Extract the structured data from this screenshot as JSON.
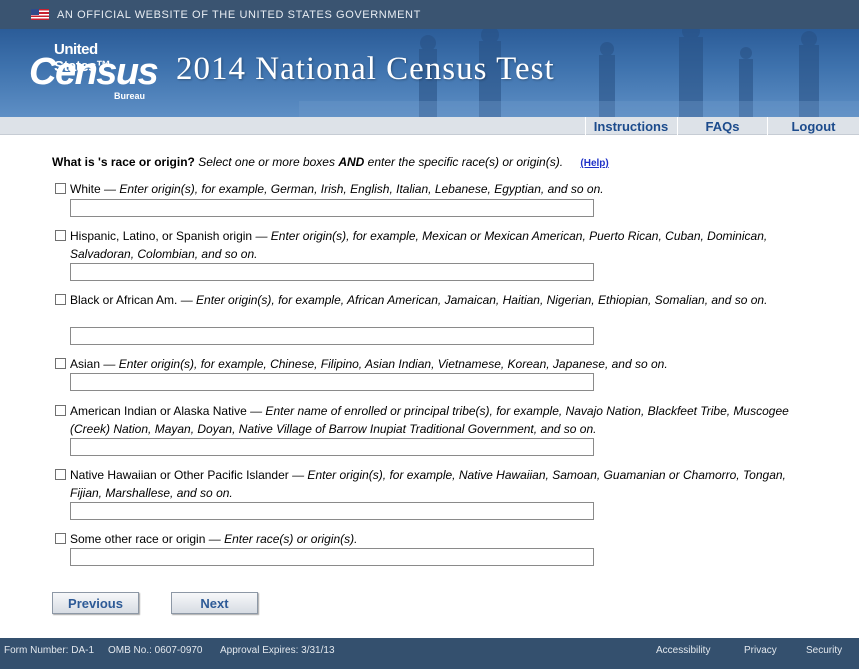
{
  "gov_banner": {
    "text": "AN OFFICIAL WEBSITE OF THE UNITED STATES GOVERNMENT"
  },
  "logo": {
    "line1": "United States™",
    "line2": "Census",
    "line3": "Bureau"
  },
  "header": {
    "title": "2014 National Census Test"
  },
  "nav": {
    "instructions": "Instructions",
    "faqs": "FAQs",
    "logout": "Logout"
  },
  "question": {
    "label": "What is 's race or origin?",
    "instruction_prefix": "Select one or more boxes ",
    "instruction_bold": "AND",
    "instruction_suffix": " enter the specific race(s) or origin(s).",
    "help": "(Help)"
  },
  "options": [
    {
      "label": "White",
      "instruction": " — Enter origin(s), for example, German, Irish, English, Italian, Lebanese, Egyptian, and so on.",
      "value": ""
    },
    {
      "label": "Hispanic, Latino, or Spanish origin",
      "instruction": " — Enter origin(s), for example, Mexican or Mexican American, Puerto Rican, Cuban, Dominican, Salvadoran, Colombian, and so on.",
      "value": ""
    },
    {
      "label": "Black or African Am.",
      "instruction": " — Enter origin(s), for example, African American, Jamaican, Haitian, Nigerian, Ethiopian, Somalian, and so on.",
      "value": ""
    },
    {
      "label": "Asian",
      "instruction": " — Enter origin(s), for example, Chinese, Filipino, Asian Indian, Vietnamese, Korean, Japanese, and so on.",
      "value": ""
    },
    {
      "label": "American Indian or Alaska Native",
      "instruction": " — Enter name of enrolled or principal tribe(s), for example, Navajo Nation, Blackfeet Tribe, Muscogee (Creek) Nation, Mayan, Doyan, Native Village of Barrow Inupiat Traditional Government, and so on.",
      "value": ""
    },
    {
      "label": "Native Hawaiian or Other Pacific Islander",
      "instruction": " — Enter origin(s), for example, Native Hawaiian, Samoan, Guamanian or Chamorro, Tongan, Fijian, Marshallese, and so on.",
      "value": ""
    },
    {
      "label": "Some other race or origin",
      "instruction": " — Enter race(s) or origin(s).",
      "value": ""
    }
  ],
  "buttons": {
    "previous": "Previous",
    "next": "Next"
  },
  "footer": {
    "form_number": "Form Number: DA-1",
    "omb": "OMB No.: 0607-0970",
    "approval": "Approval Expires: 3/31/13",
    "accessibility": "Accessibility",
    "privacy": "Privacy",
    "security": "Security"
  }
}
